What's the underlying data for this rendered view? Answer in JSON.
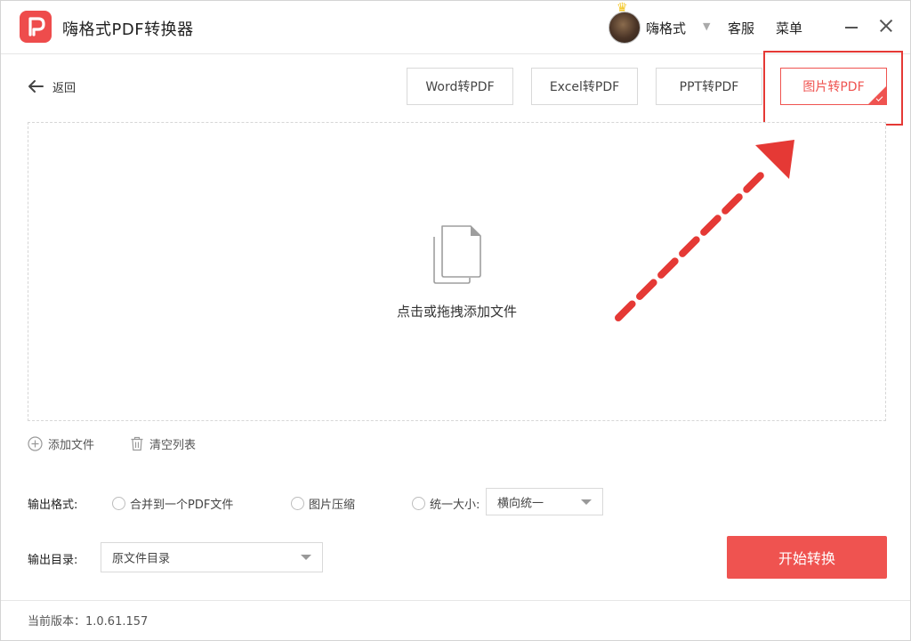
{
  "titlebar": {
    "app_title": "嗨格式PDF转换器",
    "username": "嗨格式",
    "service_label": "客服",
    "menu_label": "菜单"
  },
  "nav": {
    "back_label": "返回"
  },
  "tabs": [
    {
      "label": "Word转PDF",
      "selected": false
    },
    {
      "label": "Excel转PDF",
      "selected": false
    },
    {
      "label": "PPT转PDF",
      "selected": false
    },
    {
      "label": "图片转PDF",
      "selected": true
    }
  ],
  "dropzone": {
    "hint": "点击或拖拽添加文件"
  },
  "file_actions": {
    "add_label": "添加文件",
    "clear_label": "清空列表"
  },
  "output_format": {
    "label": "输出格式:",
    "options": [
      "合并到一个PDF文件",
      "图片压缩",
      "统一大小:"
    ],
    "size_select_value": "横向统一"
  },
  "output_dir": {
    "label": "输出目录:",
    "select_value": "原文件目录"
  },
  "actions": {
    "start_label": "开始转换"
  },
  "footer": {
    "version": "当前版本：1.0.61.157"
  },
  "colors": {
    "accent": "#ef5350",
    "annotation": "#e53935",
    "logo_bg": "#ee4c4c"
  },
  "icons": {
    "logo": "app-logo-icon",
    "crown": "crown-icon",
    "back": "arrow-left-icon",
    "file": "document-icon",
    "add": "plus-circle-icon",
    "clear": "trash-icon",
    "caret": "chevron-down-icon",
    "minimize": "minimize-icon",
    "close": "close-icon"
  }
}
